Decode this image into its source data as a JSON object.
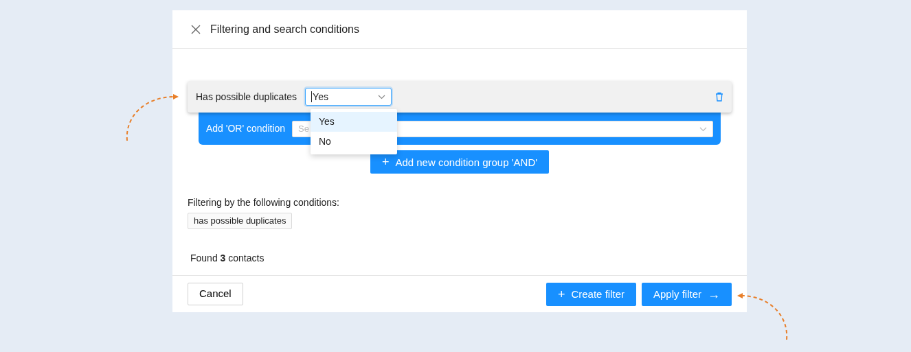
{
  "dialog": {
    "title": "Filtering and search conditions"
  },
  "condition": {
    "label": "Has possible duplicates",
    "value": "Yes",
    "expanded": true,
    "options": [
      {
        "label": "Yes",
        "selected": true
      },
      {
        "label": "No",
        "selected": false
      }
    ]
  },
  "or_condition": {
    "label": "Add 'OR' condition",
    "placeholder": "Se"
  },
  "add_group_button": {
    "icon": "+",
    "label": "Add new condition group 'AND'"
  },
  "summary": {
    "heading": "Filtering by the following conditions:",
    "tags": [
      "has possible duplicates"
    ],
    "result": "Found **3** contacts"
  },
  "footer": {
    "cancel": "Cancel",
    "create": {
      "icon": "+",
      "label": "Create filter"
    },
    "apply": {
      "label": "Apply filter",
      "icon": "→"
    }
  }
}
